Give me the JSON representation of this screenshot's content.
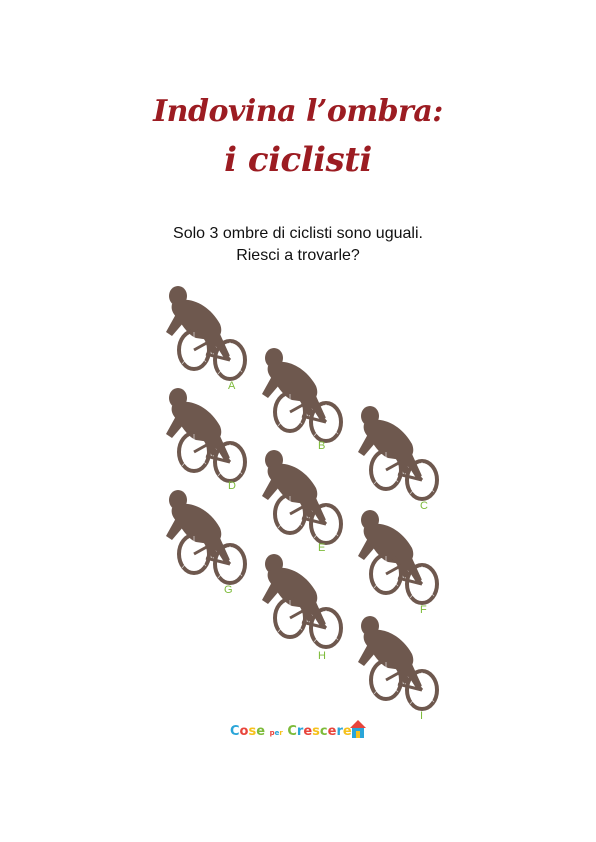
{
  "title": {
    "line1": "Indovina l’ombra:",
    "line2": "i ciclisti",
    "color": "#9c1c22"
  },
  "subtitle": {
    "line1": "Solo 3 ombre di ciclisti sono uguali.",
    "line2": "Riesci a trovarle?"
  },
  "shadow_color": "#6e584e",
  "letter_color": "#7dbb3a",
  "cyclists": [
    {
      "label": "A",
      "icon": "cyclist-silhouette"
    },
    {
      "label": "B",
      "icon": "cyclist-silhouette"
    },
    {
      "label": "C",
      "icon": "cyclist-silhouette"
    },
    {
      "label": "D",
      "icon": "cyclist-silhouette"
    },
    {
      "label": "E",
      "icon": "cyclist-silhouette"
    },
    {
      "label": "F",
      "icon": "cyclist-silhouette"
    },
    {
      "label": "G",
      "icon": "cyclist-silhouette"
    },
    {
      "label": "H",
      "icon": "cyclist-silhouette"
    },
    {
      "label": "I",
      "icon": "cyclist-silhouette"
    }
  ],
  "logo": {
    "text": "Cose per Crescere",
    "icon": "house-icon"
  }
}
